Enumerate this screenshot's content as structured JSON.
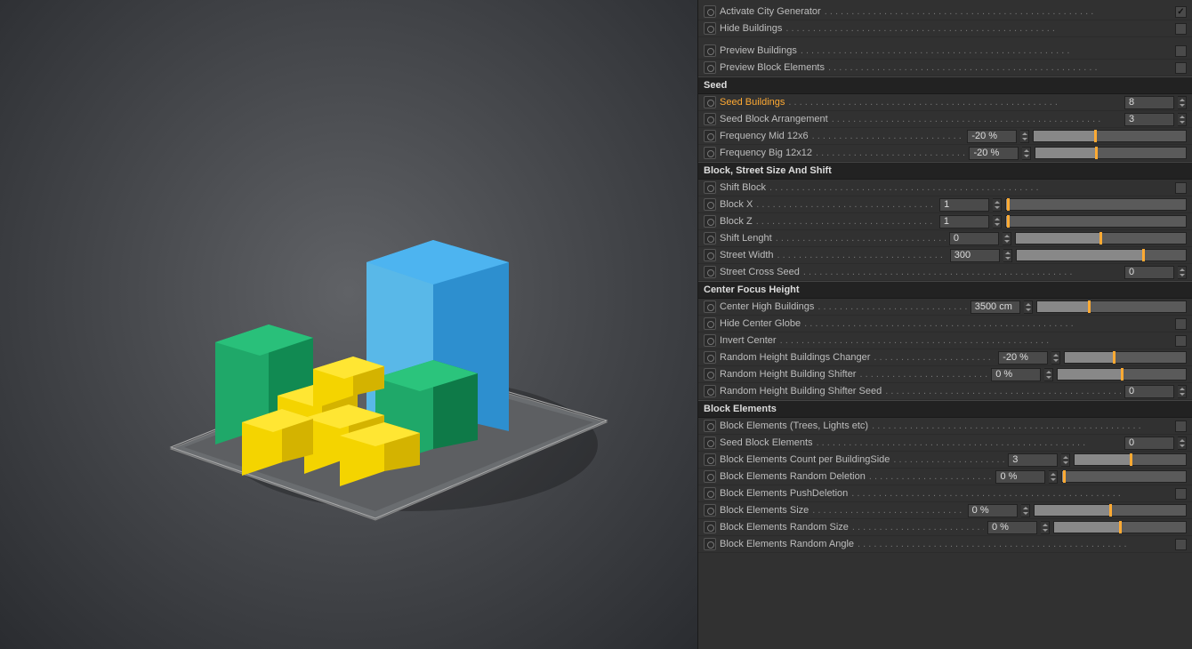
{
  "dots": ". . . . . . . . . . . . . . . . . . . . . . . . . . . . . . . . . . . . . . . . . . . . . . . . . .",
  "sections": {
    "seed": "Seed",
    "block": "Block, Street Size And Shift",
    "center": "Center Focus Height",
    "elements": "Block Elements"
  },
  "params": {
    "activateCityGenerator": {
      "label": "Activate City Generator",
      "type": "check",
      "checked": true
    },
    "hideBuildings": {
      "label": "Hide Buildings",
      "type": "check",
      "checked": false
    },
    "previewBuildings": {
      "label": "Preview Buildings",
      "type": "check",
      "checked": false
    },
    "previewBlockElements": {
      "label": "Preview Block Elements",
      "type": "check",
      "checked": false
    },
    "seedBuildings": {
      "label": "Seed Buildings",
      "type": "num",
      "value": "8",
      "highlight": true
    },
    "seedBlockArrangement": {
      "label": "Seed Block Arrangement",
      "type": "num",
      "value": "3"
    },
    "frequencyMid": {
      "label": "Frequency Mid 12x6",
      "type": "numslider",
      "value": "-20 %",
      "pos": 40
    },
    "frequencyBig": {
      "label": "Frequency Big 12x12",
      "type": "numslider",
      "value": "-20 %",
      "pos": 40
    },
    "shiftBlock": {
      "label": "Shift Block",
      "type": "check",
      "checked": false
    },
    "blockX": {
      "label": "Block X",
      "type": "numslider",
      "value": "1",
      "pos": 1
    },
    "blockZ": {
      "label": "Block Z",
      "type": "numslider",
      "value": "1",
      "pos": 1
    },
    "shiftLength": {
      "label": "Shift Lenght",
      "type": "numslider",
      "value": "0",
      "pos": 50
    },
    "streetWidth": {
      "label": "Street Width",
      "type": "numslider",
      "value": "300",
      "pos": 75
    },
    "streetCrossSeed": {
      "label": "Street Cross Seed",
      "type": "num",
      "value": "0"
    },
    "centerHighBuildings": {
      "label": "Center High Buildings",
      "type": "numslider",
      "value": "3500 cm",
      "pos": 35
    },
    "hideCenterGlobe": {
      "label": "Hide Center Globe",
      "type": "check",
      "checked": false
    },
    "invertCenter": {
      "label": "Invert Center",
      "type": "check",
      "checked": false
    },
    "randomHeightChanger": {
      "label": "Random Height Buildings Changer",
      "type": "numslider",
      "value": "-20 %",
      "pos": 40
    },
    "randomHeightShifter": {
      "label": "Random Height Building Shifter",
      "type": "numslider",
      "value": "0 %",
      "pos": 50
    },
    "randomHeightShifterSeed": {
      "label": "Random Height Building Shifter Seed",
      "type": "num",
      "value": "0"
    },
    "blockElementsToggle": {
      "label": "Block Elements (Trees, Lights etc)",
      "type": "check",
      "checked": false
    },
    "seedBlockElements": {
      "label": "Seed Block Elements",
      "type": "num",
      "value": "0"
    },
    "blockElementsCount": {
      "label": "Block Elements Count per BuildingSide",
      "type": "numslider",
      "value": "3",
      "pos": 50
    },
    "blockElementsRandomDeletion": {
      "label": "Block Elements Random Deletion",
      "type": "numslider",
      "value": "0 %",
      "pos": 1
    },
    "blockElementsPushDeletion": {
      "label": "Block Elements PushDeletion",
      "type": "check",
      "checked": false
    },
    "blockElementsSize": {
      "label": "Block Elements Size",
      "type": "numslider",
      "value": "0 %",
      "pos": 50
    },
    "blockElementsRandomSize": {
      "label": "Block Elements Random Size",
      "type": "numslider",
      "value": "0 %",
      "pos": 50
    },
    "blockElementsRandomAngle": {
      "label": "Block Elements Random Angle",
      "type": "check",
      "checked": false
    }
  }
}
